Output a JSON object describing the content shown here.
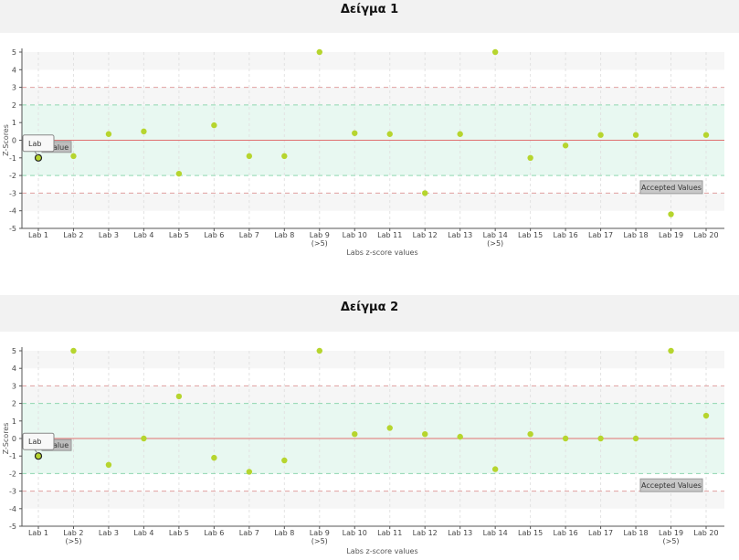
{
  "chart_data": [
    {
      "type": "scatter",
      "title": "Δείγμα 1",
      "xlabel": "Labs z-score values",
      "ylabel": "Z-Scores",
      "ylim": [
        -5,
        5
      ],
      "yticks": [
        "5",
        "4",
        "3",
        "2",
        "1",
        "0",
        "-1",
        "-2",
        "-3",
        "-4",
        "-5"
      ],
      "categories": [
        "Lab 1",
        "Lab 2",
        "Lab 3",
        "Lab 4",
        "Lab 5",
        "Lab 6",
        "Lab 7",
        "Lab 8",
        "Lab 9",
        "Lab 10",
        "Lab 11",
        "Lab 12",
        "Lab 13",
        "Lab 14",
        "Lab 15",
        "Lab 16",
        "Lab 17",
        "Lab 18",
        "Lab 19",
        "Lab 20"
      ],
      "category_notes": [
        "",
        "",
        "",
        "",
        "",
        "",
        "",
        "",
        "(>5)",
        "",
        "",
        "",
        "",
        "(>5)",
        "",
        "",
        "",
        "",
        "",
        ""
      ],
      "values": [
        -1.0,
        -0.9,
        0.35,
        0.5,
        -1.9,
        0.85,
        -0.9,
        -0.9,
        5.0,
        0.4,
        0.35,
        -3.0,
        0.35,
        5.0,
        -1.0,
        -0.3,
        0.3,
        0.3,
        -4.2,
        0.3
      ],
      "reference_lines": {
        "center": 0,
        "warning": [
          2,
          -2
        ],
        "action": [
          3,
          -3
        ]
      },
      "accepted_band": [
        -2,
        2
      ],
      "accepted_label": "Accepted Values",
      "tooltip": {
        "title": "Lab",
        "partial_label": "alue"
      },
      "colors": {
        "point": "#b6d52e",
        "center": "#e07070",
        "warning": "#8fd6b0",
        "action": "#e0a0a0",
        "band": "#e8f8f1"
      }
    },
    {
      "type": "scatter",
      "title": "Δείγμα 2",
      "xlabel": "Labs z-score values",
      "ylabel": "Z-Scores",
      "ylim": [
        -5,
        5
      ],
      "yticks": [
        "5",
        "4",
        "3",
        "2",
        "1",
        "0",
        "-1",
        "-2",
        "-3",
        "-4",
        "-5"
      ],
      "categories": [
        "Lab 1",
        "Lab 2",
        "Lab 3",
        "Lab 4",
        "Lab 5",
        "Lab 6",
        "Lab 7",
        "Lab 8",
        "Lab 9",
        "Lab 10",
        "Lab 11",
        "Lab 12",
        "Lab 13",
        "Lab 14",
        "Lab 15",
        "Lab 16",
        "Lab 17",
        "Lab 18",
        "Lab 19",
        "Lab 20"
      ],
      "category_notes": [
        "",
        "(>5)",
        "",
        "",
        "",
        "",
        "",
        "",
        "(>5)",
        "",
        "",
        "",
        "",
        "",
        "",
        "",
        "",
        "",
        "(>5)",
        ""
      ],
      "values": [
        -1.0,
        5.0,
        -1.5,
        0.0,
        2.4,
        -1.1,
        -1.9,
        -1.25,
        5.0,
        0.25,
        0.6,
        0.25,
        0.1,
        -1.75,
        0.25,
        0.0,
        0.0,
        0.0,
        5.0,
        1.3
      ],
      "reference_lines": {
        "center": 0,
        "warning": [
          2,
          -2
        ],
        "action": [
          3,
          -3
        ]
      },
      "accepted_band": [
        -2,
        2
      ],
      "accepted_label": "Accepted Values",
      "tooltip": {
        "title": "Lab",
        "partial_label": "alue"
      },
      "colors": {
        "point": "#b6d52e",
        "center": "#e07070",
        "warning": "#8fd6b0",
        "action": "#e0a0a0",
        "band": "#e8f8f1"
      }
    }
  ]
}
